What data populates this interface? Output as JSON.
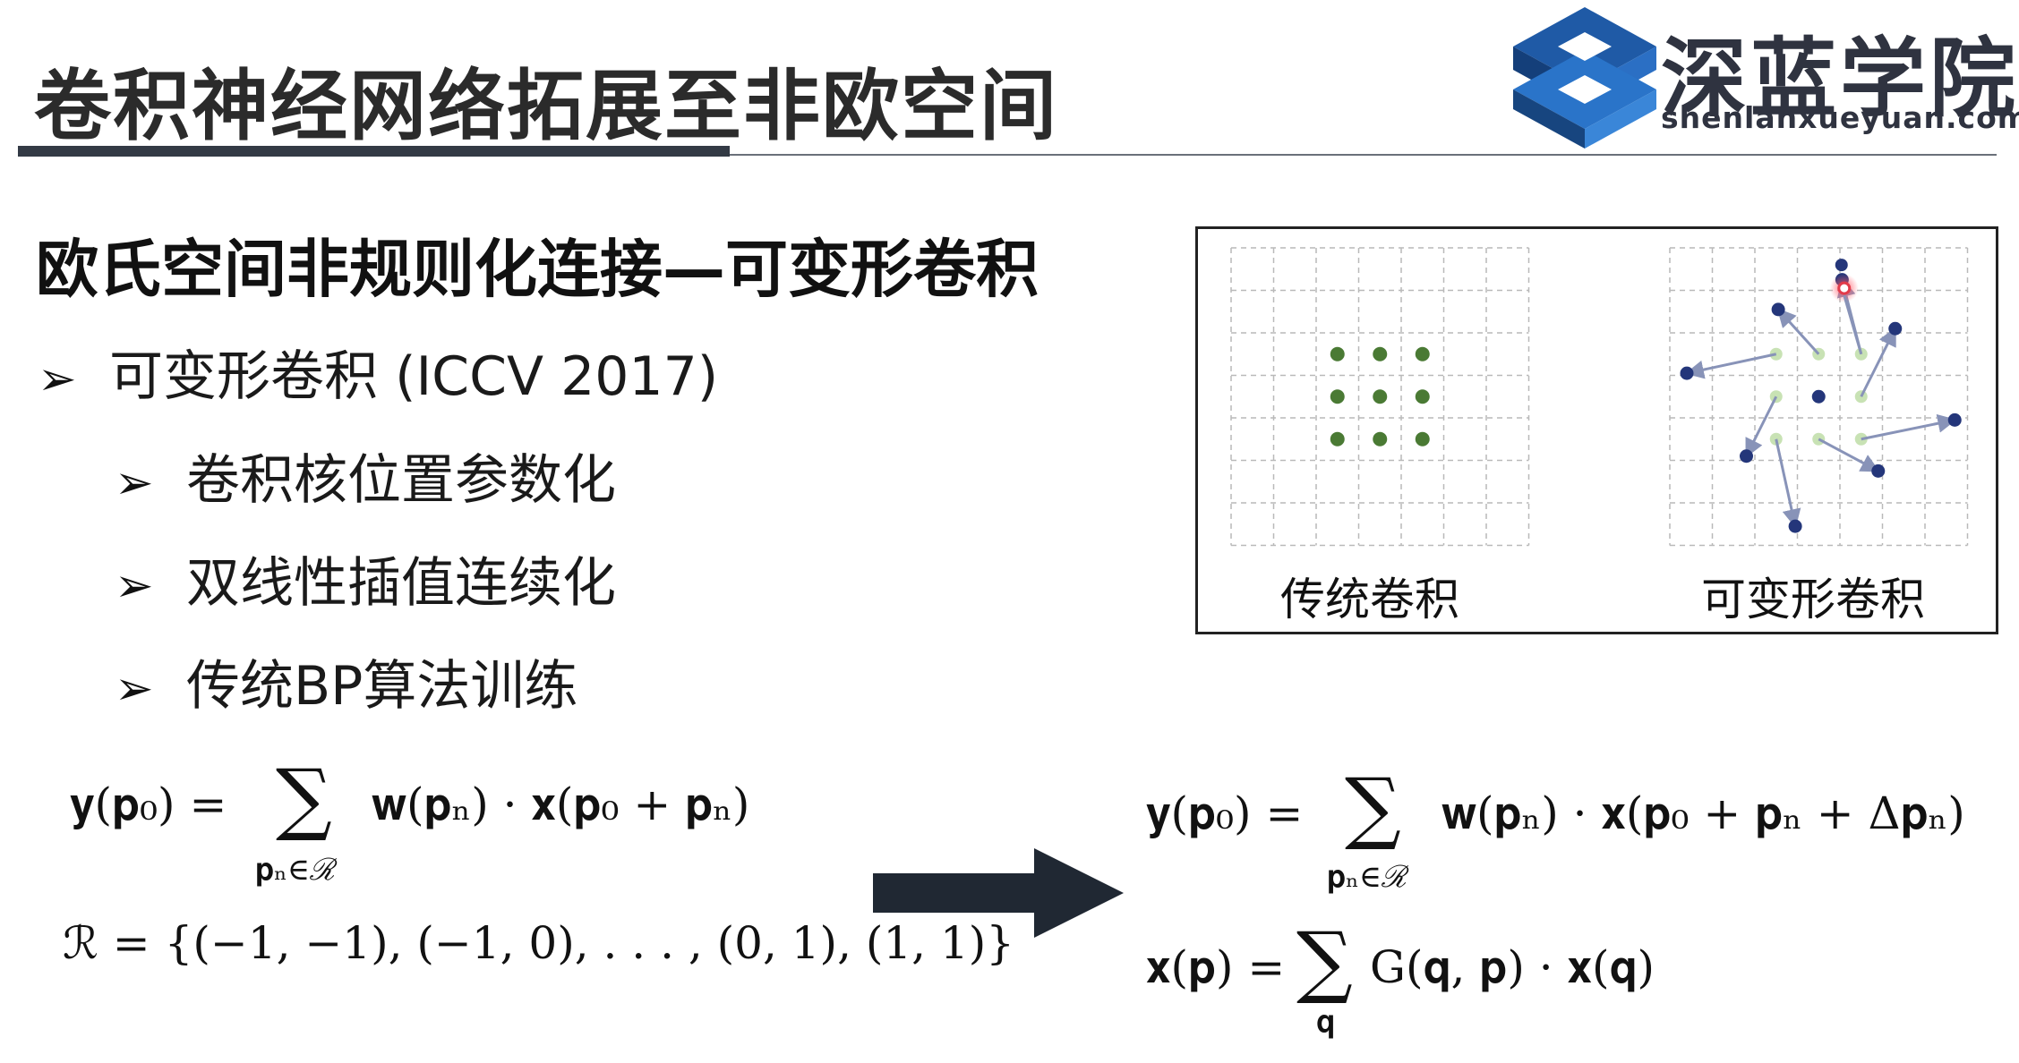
{
  "header": {
    "title": "卷积神经网络拓展至非欧空间",
    "logo_text": "深蓝学院",
    "logo_url": "shenlanxueyuan.com"
  },
  "section": {
    "heading": "欧氏空间非规则化连接—可变形卷积"
  },
  "bullets": [
    {
      "marker": "➢",
      "text": "可变形卷积 (ICCV 2017)"
    },
    {
      "marker": "➢",
      "text": "卷积核位置参数化"
    },
    {
      "marker": "➢",
      "text": "双线性插值连续化"
    },
    {
      "marker": "➢",
      "text": "传统BP算法训练"
    }
  ],
  "figure": {
    "left_caption": "传统卷积",
    "right_caption": "可变形卷积",
    "colors": {
      "sample_dark_green": "#4a7a34",
      "sample_light_green": "#c8e2b4",
      "offset_blue": "#24367a",
      "offset_arrow": "#8893b8",
      "highlight_red": "#e23b4a"
    }
  },
  "formulas": {
    "left_main": "𝐲(𝐩₀) =",
    "left_sigma": "∑",
    "left_rest": "𝐰(𝐩ₙ) · 𝐱(𝐩₀ + 𝐩ₙ)",
    "left_under": "𝐩ₙ∈ℛ",
    "left_set": "ℛ = {(−1, −1), (−1, 0), . . . , (0, 1), (1, 1)}",
    "right1_main": "𝐲(𝐩₀) =",
    "right1_sigma": "∑",
    "right1_rest": "𝐰(𝐩ₙ) · 𝐱(𝐩₀ + 𝐩ₙ + Δ𝐩ₙ)",
    "right1_under": "𝐩ₙ∈ℛ",
    "right2_main": "𝐱(𝐩) =",
    "right2_sigma": "∑",
    "right2_rest": "G(𝐪, 𝐩) · 𝐱(𝐪)",
    "right2_under": "𝐪"
  }
}
